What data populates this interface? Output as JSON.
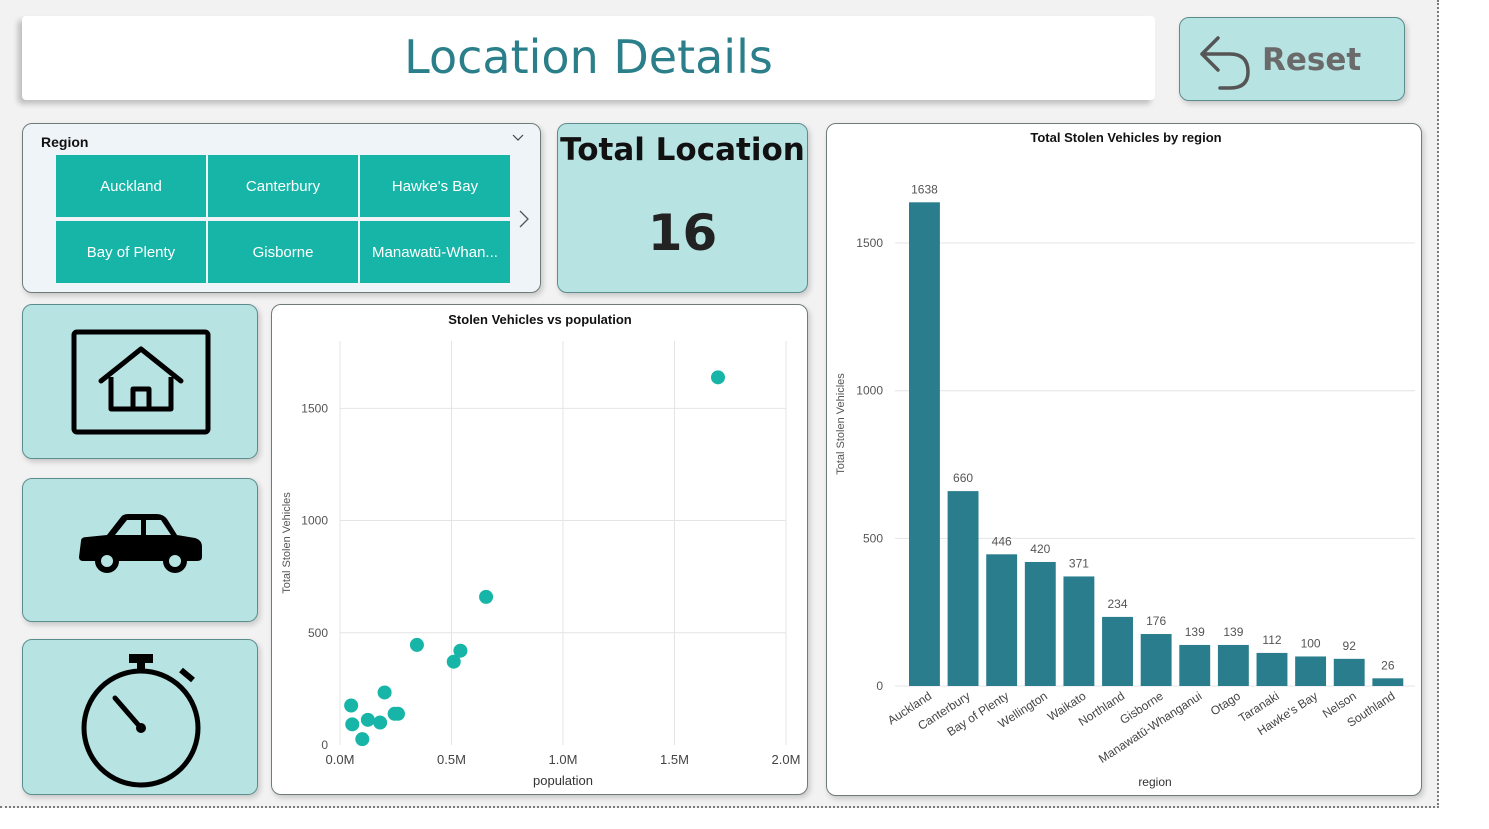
{
  "header": {
    "title": "Location Details"
  },
  "reset_button": {
    "label": "Reset",
    "icon": "undo-arrow-icon"
  },
  "region_slicer": {
    "header": "Region",
    "items": [
      "Auckland",
      "Canterbury",
      "Hawke's Bay",
      "Bay of Plenty",
      "Gisborne",
      "Manawatū-Whan..."
    ]
  },
  "kpi": {
    "title": "Total Location",
    "value": "16"
  },
  "nav": [
    {
      "icon": "home-icon"
    },
    {
      "icon": "car-icon"
    },
    {
      "icon": "stopwatch-icon"
    }
  ],
  "colors": {
    "accent": "#17b5a8",
    "bar": "#2a7d8c",
    "tile_bg": "#b8e3e3",
    "title": "#2b7f8a"
  },
  "chart_data": [
    {
      "type": "scatter",
      "title": "Stolen Vehicles vs population",
      "xlabel": "population",
      "ylabel": "Total Stolen Vehicles",
      "xlim": [
        0,
        2000000
      ],
      "ylim": [
        0,
        1800
      ],
      "x_ticks": [
        "0.0M",
        "0.5M",
        "1.0M",
        "1.5M",
        "2.0M"
      ],
      "x_tick_values": [
        0,
        500000,
        1000000,
        1500000,
        2000000
      ],
      "y_ticks": [
        "0",
        "500",
        "1000",
        "1500"
      ],
      "y_tick_values": [
        0,
        500,
        1000,
        1500
      ],
      "grid": true,
      "points": [
        {
          "x": 1695000,
          "y": 1638
        },
        {
          "x": 655000,
          "y": 660
        },
        {
          "x": 345000,
          "y": 446
        },
        {
          "x": 540000,
          "y": 420
        },
        {
          "x": 510000,
          "y": 371
        },
        {
          "x": 200000,
          "y": 234
        },
        {
          "x": 50000,
          "y": 176
        },
        {
          "x": 260000,
          "y": 139
        },
        {
          "x": 245000,
          "y": 139
        },
        {
          "x": 125000,
          "y": 112
        },
        {
          "x": 180000,
          "y": 100
        },
        {
          "x": 55000,
          "y": 92
        },
        {
          "x": 100000,
          "y": 26
        }
      ]
    },
    {
      "type": "bar",
      "title": "Total Stolen Vehicles by region",
      "xlabel": "region",
      "ylabel": "Total Stolen Vehicles",
      "ylim": [
        0,
        1700
      ],
      "y_ticks": [
        "0",
        "500",
        "1000",
        "1500"
      ],
      "y_tick_values": [
        0,
        500,
        1000,
        1500
      ],
      "grid": true,
      "categories": [
        "Auckland",
        "Canterbury",
        "Bay of Plenty",
        "Wellington",
        "Waikato",
        "Northland",
        "Gisborne",
        "Manawatū-Whanganui",
        "Otago",
        "Taranaki",
        "Hawke's Bay",
        "Nelson",
        "Southland"
      ],
      "values": [
        1638,
        660,
        446,
        420,
        371,
        234,
        176,
        139,
        139,
        112,
        100,
        92,
        26
      ]
    }
  ]
}
